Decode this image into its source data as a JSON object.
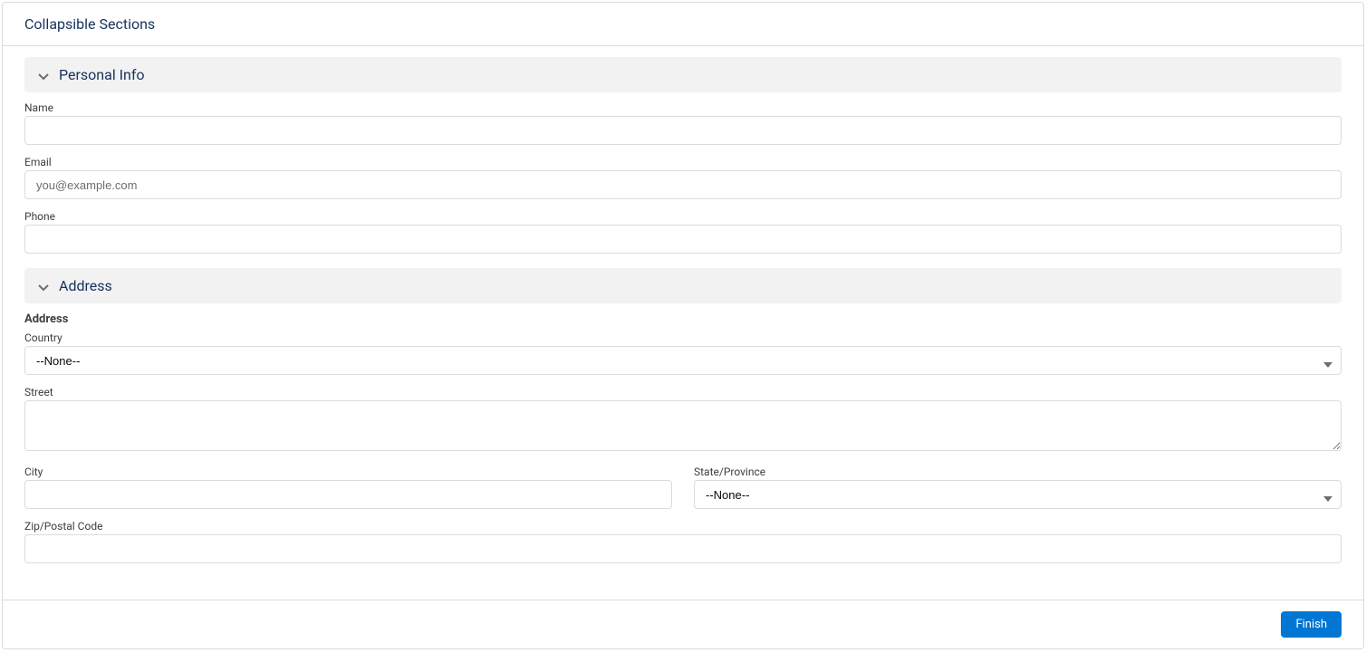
{
  "card": {
    "title": "Collapsible Sections"
  },
  "sections": {
    "personal": {
      "title": "Personal Info",
      "fields": {
        "name": {
          "label": "Name",
          "value": ""
        },
        "email": {
          "label": "Email",
          "value": "",
          "placeholder": "you@example.com"
        },
        "phone": {
          "label": "Phone",
          "value": ""
        }
      }
    },
    "address": {
      "title": "Address",
      "group_label": "Address",
      "fields": {
        "country": {
          "label": "Country",
          "value": "--None--"
        },
        "street": {
          "label": "Street",
          "value": ""
        },
        "city": {
          "label": "City",
          "value": ""
        },
        "state": {
          "label": "State/Province",
          "value": "--None--"
        },
        "zip": {
          "label": "Zip/Postal Code",
          "value": ""
        }
      }
    }
  },
  "footer": {
    "finish_label": "Finish"
  }
}
